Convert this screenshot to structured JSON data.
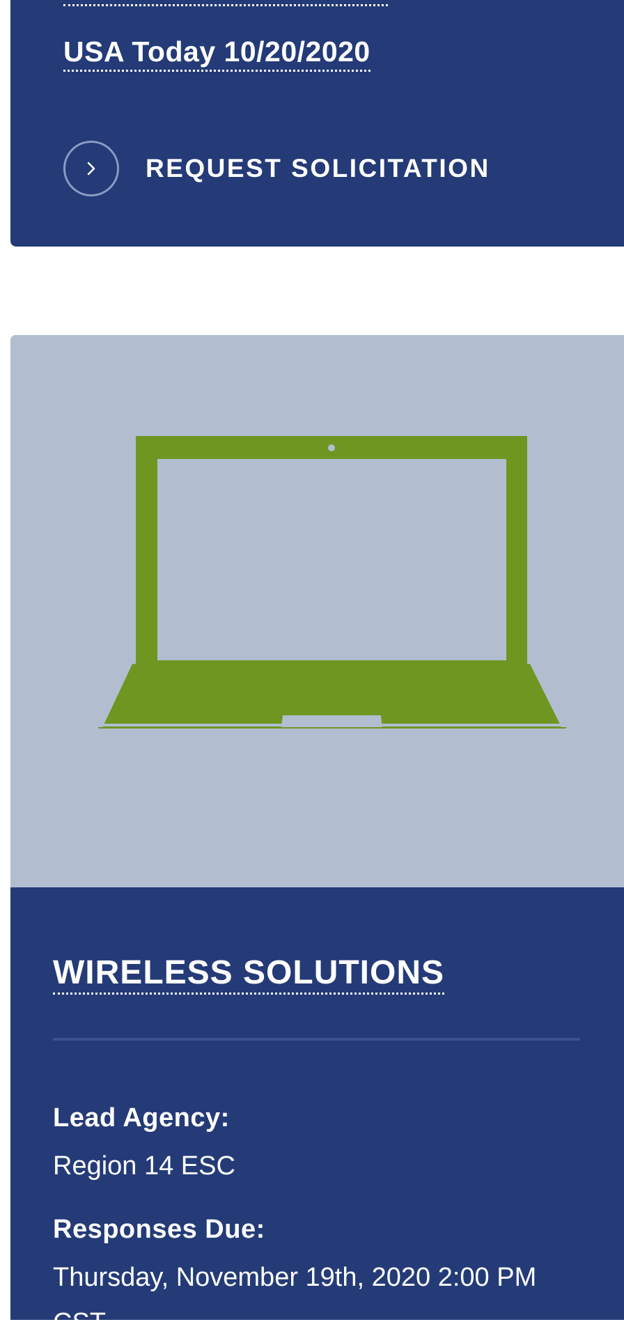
{
  "previous_card": {
    "press_link": "USA Today 10/20/2020",
    "action_label": "REQUEST SOLICITATION",
    "action_icon": "chevron-right-icon"
  },
  "solicitation": {
    "image_icon": "laptop-icon",
    "title": "WIRELESS SOLUTIONS",
    "lead_agency_label": "Lead Agency:",
    "lead_agency_value": "Region 14 ESC",
    "responses_due_label": "Responses Due:",
    "responses_due_value": "Thursday, November 19th, 2020 2:00 PM",
    "responses_due_value_overflow": "CST"
  },
  "colors": {
    "card_bg": "#243b77",
    "image_bg": "#b2bed0",
    "laptop_green": "#6e9621",
    "divider": "#3b5291",
    "circle_border": "#8b9bc3"
  }
}
